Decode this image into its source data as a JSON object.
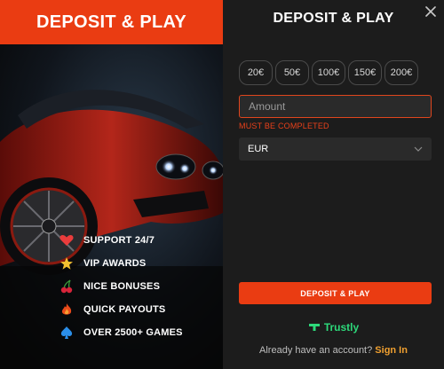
{
  "left": {
    "header_title": "DEPOSIT & PLAY",
    "features": [
      {
        "icon": "heart-icon",
        "label": "SUPPORT 24/7"
      },
      {
        "icon": "star-icon",
        "label": "VIP AWARDS"
      },
      {
        "icon": "cherries-icon",
        "label": "NICE BONUSES"
      },
      {
        "icon": "flame-icon",
        "label": "QUICK PAYOUTS"
      },
      {
        "icon": "spade-icon",
        "label": "OVER 2500+ GAMES"
      }
    ]
  },
  "right": {
    "title": "DEPOSIT & PLAY",
    "chips": [
      "20€",
      "50€",
      "100€",
      "150€",
      "200€"
    ],
    "amount": {
      "placeholder": "Amount",
      "value": ""
    },
    "error": "MUST BE COMPLETED",
    "currency": {
      "selected": "EUR"
    },
    "deposit_button": "DEPOSIT & PLAY",
    "payment_provider": "Trustly",
    "signin_prompt": "Already have an account?",
    "signin_link": "Sign In"
  },
  "colors": {
    "accent": "#ea3c12",
    "trustly": "#2dd87a",
    "link": "#f0a030",
    "error": "#e8401a"
  }
}
